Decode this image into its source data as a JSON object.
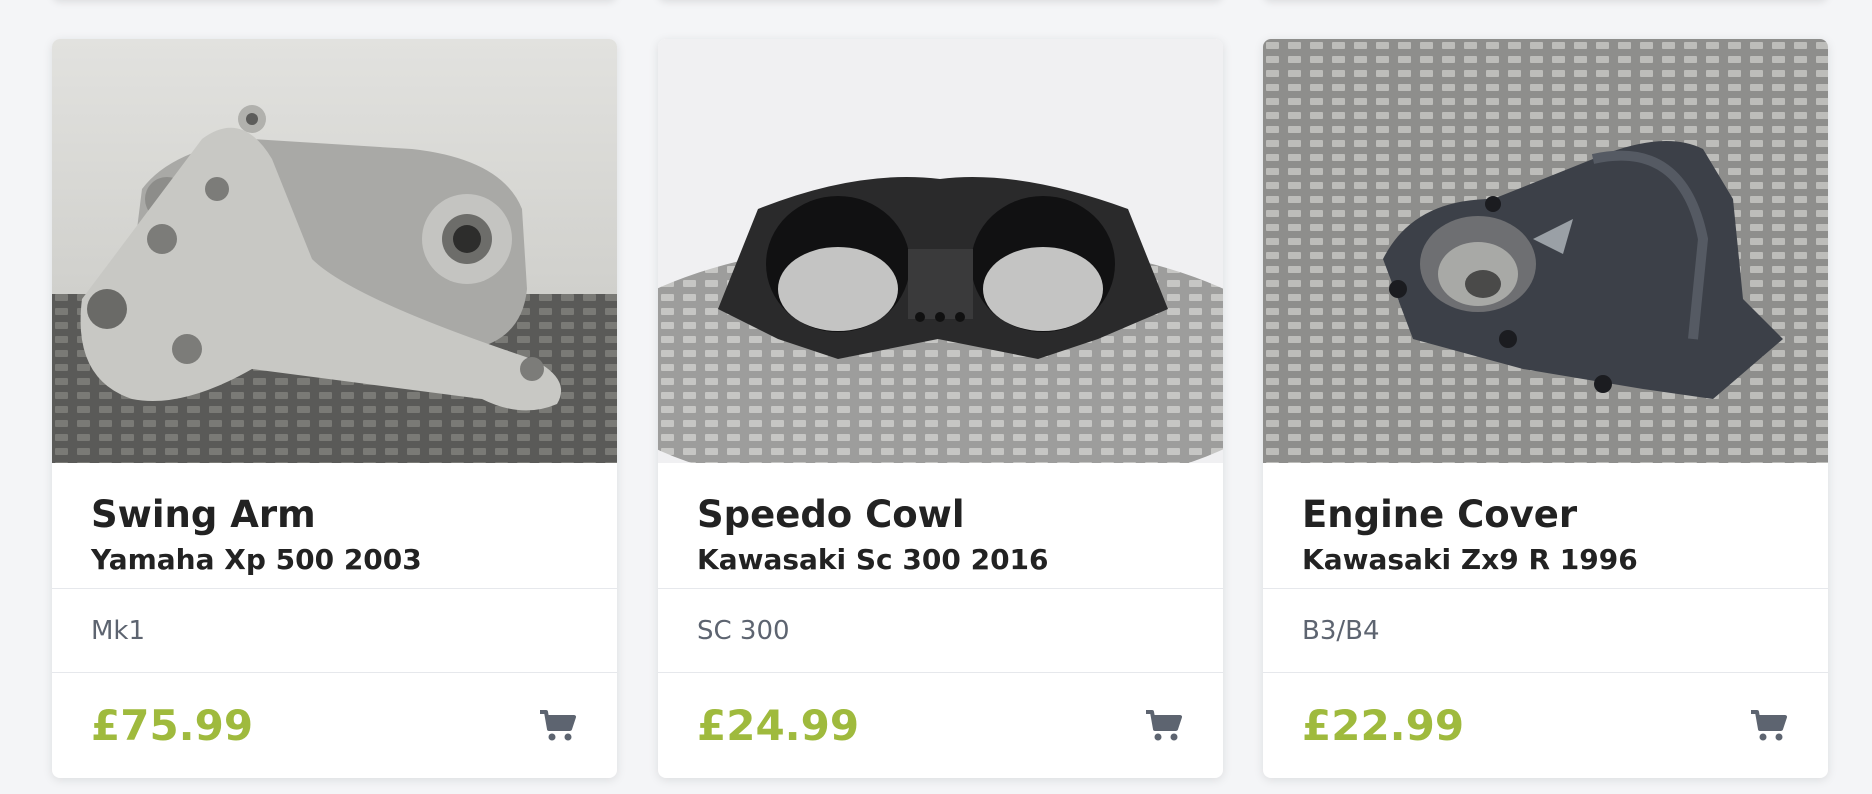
{
  "products": [
    {
      "part_name": "Swing Arm",
      "vehicle": "Yamaha Xp 500 2003",
      "variant": "Mk1",
      "price": "£75.99",
      "image_icon": "swing-arm-photo"
    },
    {
      "part_name": "Speedo Cowl",
      "vehicle": "Kawasaki Sc 300 2016",
      "variant": "SC 300",
      "price": "£24.99",
      "image_icon": "speedo-cowl-photo"
    },
    {
      "part_name": "Engine Cover",
      "vehicle": "Kawasaki Zx9 R 1996",
      "variant": "B3/B4",
      "price": "£22.99",
      "image_icon": "engine-cover-photo"
    }
  ],
  "colors": {
    "price": "#9fba3d",
    "cart_icon": "#5d6470",
    "title": "#222222"
  },
  "cart_icon": "shopping-cart-icon"
}
